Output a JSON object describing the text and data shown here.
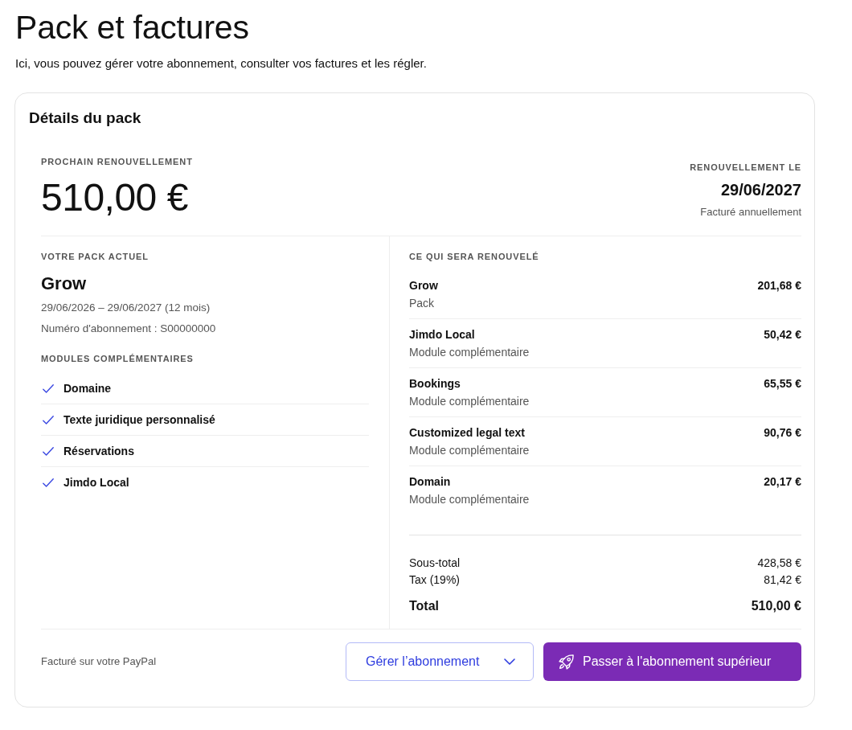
{
  "page": {
    "title": "Pack et factures",
    "description": "Ici, vous pouvez gérer votre abonnement, consulter vos factures et les régler."
  },
  "card": {
    "title": "Détails du pack"
  },
  "renewal": {
    "label": "PROCHAIN RENOUVELLEMENT",
    "amount": "510,00 €",
    "date_label": "RENOUVELLEMENT LE",
    "date": "29/06/2027",
    "billing": "Facturé annuellement"
  },
  "current_pack": {
    "label": "VOTRE PACK ACTUEL",
    "name": "Grow",
    "period": "29/06/2026 – 29/06/2027 (12 mois)",
    "subscription_number": "Numéro d'abonnement : S00000000",
    "addons_label": "MODULES COMPLÉMENTAIRES",
    "addons": [
      "Domaine",
      "Texte juridique personnalisé",
      "Réservations",
      "Jimdo Local"
    ]
  },
  "renewed": {
    "label": "CE QUI SERA RENOUVELÉ",
    "items": [
      {
        "name": "Grow",
        "type": "Pack",
        "price": "201,68 €"
      },
      {
        "name": "Jimdo Local",
        "type": "Module complémentaire",
        "price": "50,42 €"
      },
      {
        "name": "Bookings",
        "type": "Module complémentaire",
        "price": "65,55 €"
      },
      {
        "name": "Customized legal text",
        "type": "Module complémentaire",
        "price": "90,76 €"
      },
      {
        "name": "Domain",
        "type": "Module complémentaire",
        "price": "20,17 €"
      }
    ],
    "totals": [
      {
        "kind": "line",
        "label": "Sous-total",
        "amount": "428,58 €"
      },
      {
        "kind": "line",
        "label": "Tax (19%)",
        "amount": "81,42 €"
      },
      {
        "kind": "total",
        "label": "Total",
        "amount": "510,00 €"
      }
    ]
  },
  "footer": {
    "payment_note": "Facturé sur votre PayPal",
    "buttons": [
      {
        "kind": "secondary",
        "label": "Gérer l’abonnement"
      },
      {
        "kind": "primary",
        "label": "Passer à l'abonnement supérieur"
      }
    ]
  }
}
